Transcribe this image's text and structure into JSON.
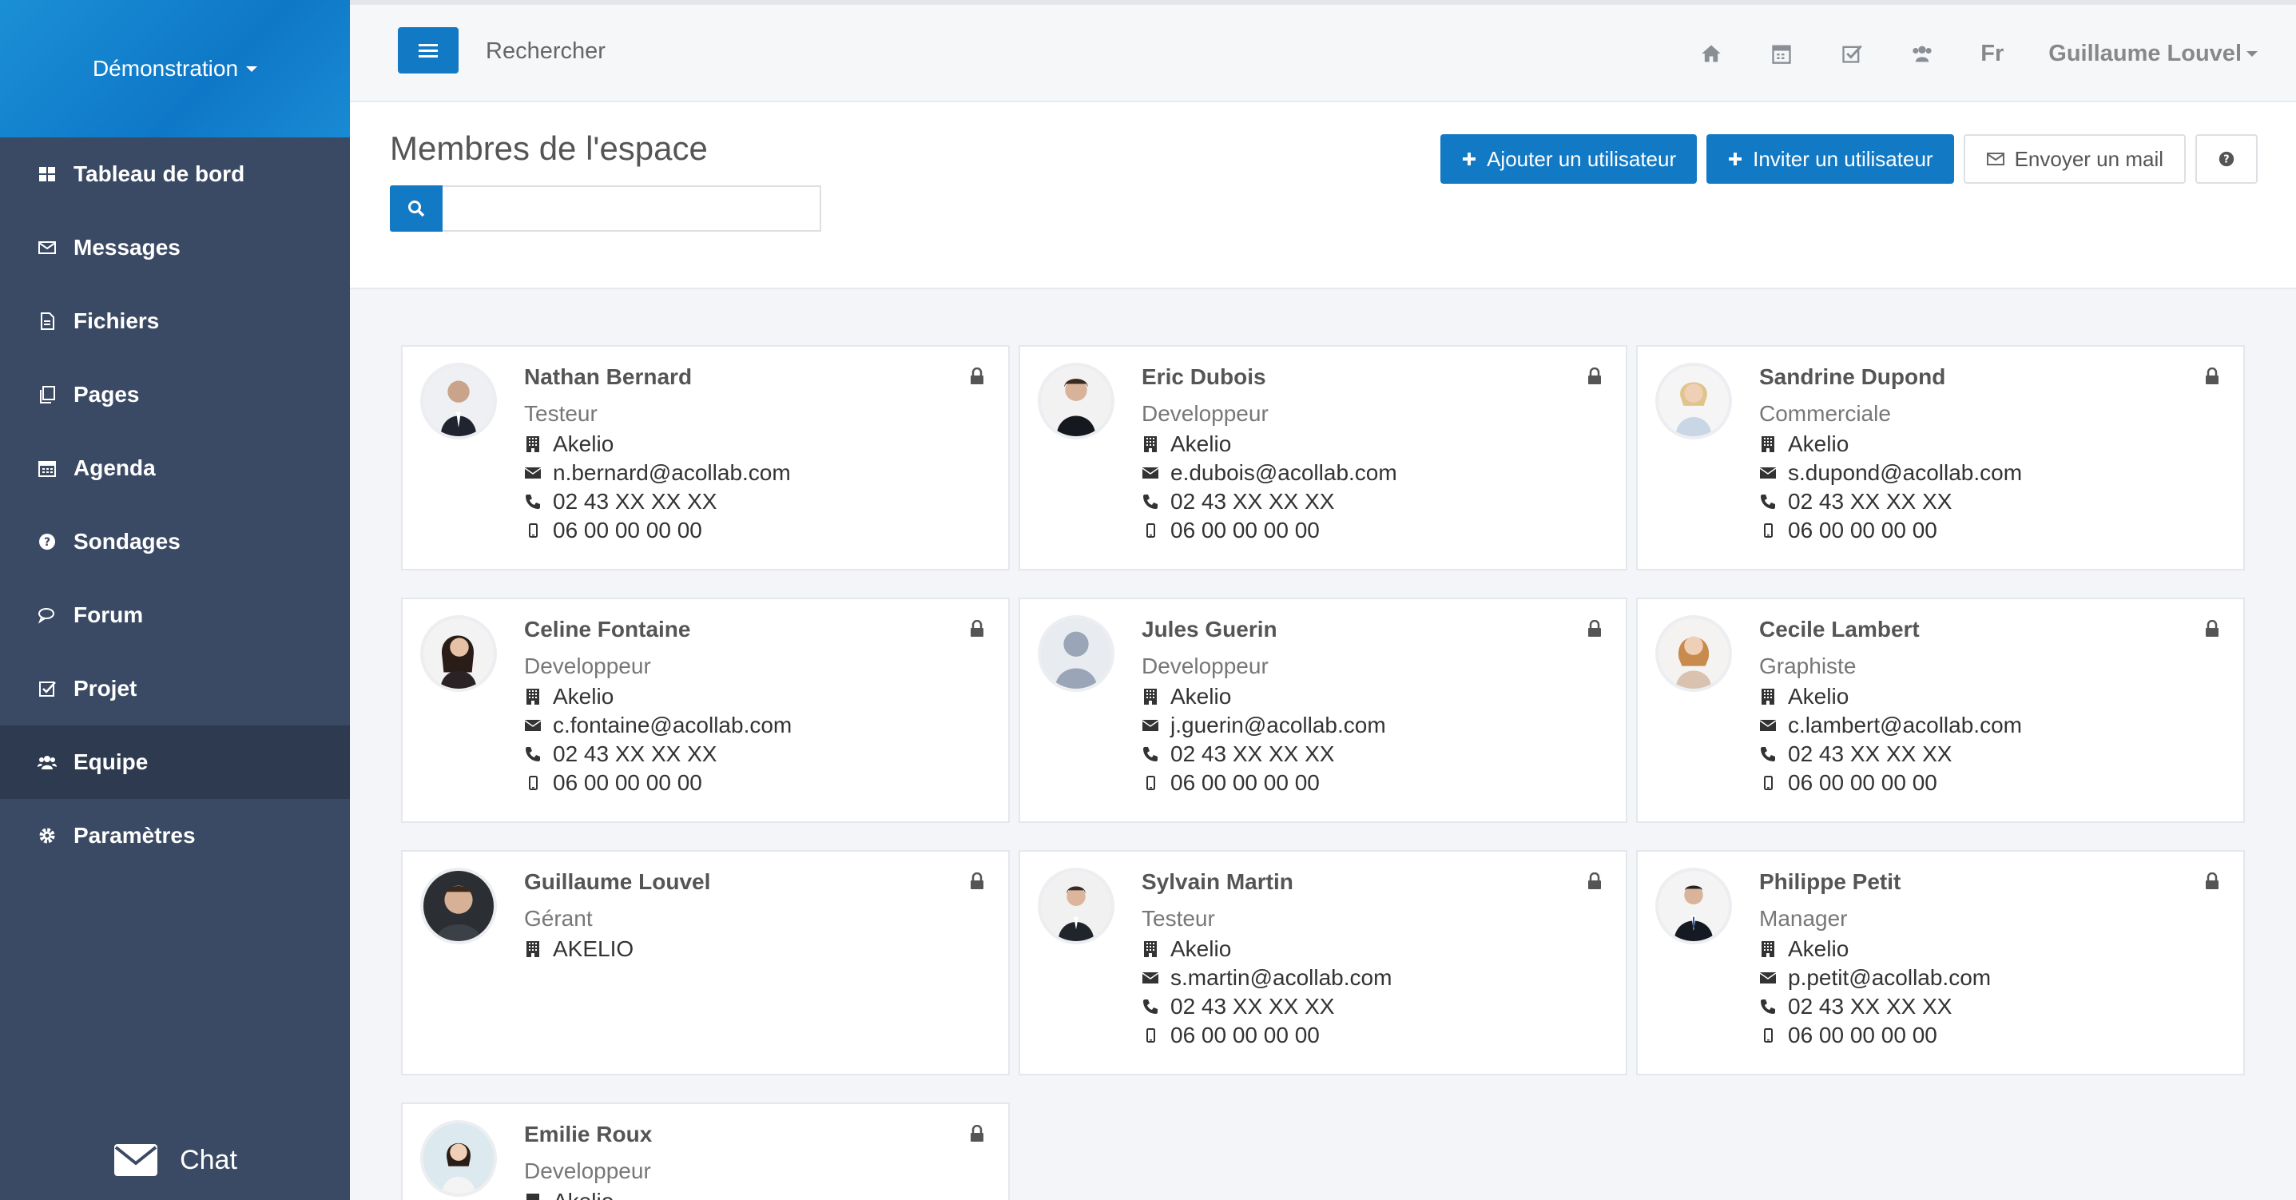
{
  "sidebar": {
    "brand": "Démonstration",
    "items": [
      {
        "label": "Tableau de bord",
        "icon": "dashboard-icon"
      },
      {
        "label": "Messages",
        "icon": "envelope-icon"
      },
      {
        "label": "Fichiers",
        "icon": "file-icon"
      },
      {
        "label": "Pages",
        "icon": "pages-icon"
      },
      {
        "label": "Agenda",
        "icon": "calendar-icon"
      },
      {
        "label": "Sondages",
        "icon": "question-icon"
      },
      {
        "label": "Forum",
        "icon": "comments-icon"
      },
      {
        "label": "Projet",
        "icon": "check-square-icon"
      },
      {
        "label": "Equipe",
        "icon": "users-icon",
        "active": true
      },
      {
        "label": "Paramètres",
        "icon": "gear-icon"
      }
    ],
    "chat_label": "Chat"
  },
  "topbar": {
    "search_label": "Rechercher",
    "lang": "Fr",
    "user": "Guillaume Louvel"
  },
  "page": {
    "title": "Membres de l'espace",
    "search_placeholder": "",
    "actions": {
      "add_user": "Ajouter un utilisateur",
      "invite_user": "Inviter un utilisateur",
      "send_mail": "Envoyer un mail"
    }
  },
  "members": [
    {
      "name": "Nathan Bernard",
      "role": "Testeur",
      "company": "Akelio",
      "email": "n.bernard@acollab.com",
      "phone": "02 43 XX XX XX",
      "mobile": "06 00 00 00 00"
    },
    {
      "name": "Eric Dubois",
      "role": "Developpeur",
      "company": "Akelio",
      "email": "e.dubois@acollab.com",
      "phone": "02 43 XX XX XX",
      "mobile": "06 00 00 00 00"
    },
    {
      "name": "Sandrine Dupond",
      "role": "Commerciale",
      "company": "Akelio",
      "email": "s.dupond@acollab.com",
      "phone": "02 43 XX XX XX",
      "mobile": "06 00 00 00 00"
    },
    {
      "name": "Celine Fontaine",
      "role": "Developpeur",
      "company": "Akelio",
      "email": "c.fontaine@acollab.com",
      "phone": "02 43 XX XX XX",
      "mobile": "06 00 00 00 00"
    },
    {
      "name": "Jules Guerin",
      "role": "Developpeur",
      "company": "Akelio",
      "email": "j.guerin@acollab.com",
      "phone": "02 43 XX XX XX",
      "mobile": "06 00 00 00 00"
    },
    {
      "name": "Cecile Lambert",
      "role": "Graphiste",
      "company": "Akelio",
      "email": "c.lambert@acollab.com",
      "phone": "02 43 XX XX XX",
      "mobile": "06 00 00 00 00"
    },
    {
      "name": "Guillaume Louvel",
      "role": "Gérant",
      "company": "AKELIO"
    },
    {
      "name": "Sylvain Martin",
      "role": "Testeur",
      "company": "Akelio",
      "email": "s.martin@acollab.com",
      "phone": "02 43 XX XX XX",
      "mobile": "06 00 00 00 00"
    },
    {
      "name": "Philippe Petit",
      "role": "Manager",
      "company": "Akelio",
      "email": "p.petit@acollab.com",
      "phone": "02 43 XX XX XX",
      "mobile": "06 00 00 00 00"
    },
    {
      "name": "Emilie Roux",
      "role": "Developpeur",
      "company": "Akelio"
    }
  ],
  "colors": {
    "sidebar": "#3b4a64",
    "sidebar_active": "#2d3a4f",
    "primary": "#1279c5"
  }
}
